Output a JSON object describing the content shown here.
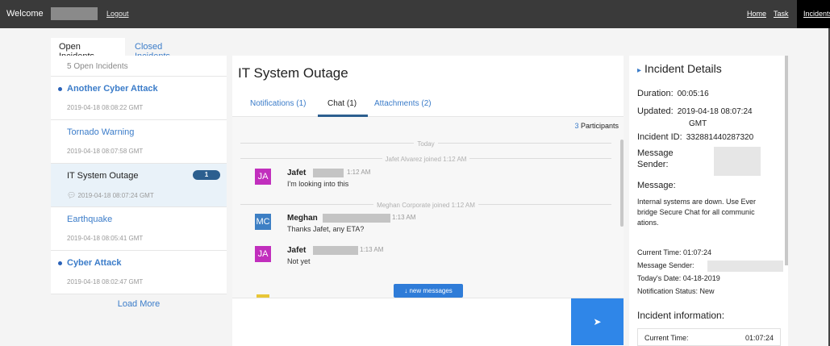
{
  "topbar": {
    "welcome": "Welcome",
    "logout": "Logout",
    "nav": [
      "Home",
      "Task",
      "Incidents"
    ]
  },
  "tabs": [
    "Open Incidents",
    "Closed Incidents"
  ],
  "incidents": {
    "count_label": "5 Open Incidents",
    "items": [
      {
        "title": "Another Cyber Attack",
        "date": "2019-04-18 08:08:22 GMT",
        "unread": true
      },
      {
        "title": "Tornado Warning",
        "date": "2019-04-18 08:07:58 GMT",
        "unread": false
      },
      {
        "title": "IT System Outage",
        "date": "2019-04-18 08:07:24 GMT",
        "unread": false,
        "badge": "1"
      },
      {
        "title": "Earthquake",
        "date": "2019-04-18 08:05:41 GMT",
        "unread": false
      },
      {
        "title": "Cyber Attack",
        "date": "2019-04-18 08:02:47 GMT",
        "unread": true
      }
    ],
    "load_more": "Load More"
  },
  "main": {
    "title": "IT System Outage",
    "tabs": [
      "Notifications (1)",
      "Chat (1)",
      "Attachments (2)"
    ],
    "participants_count": "3",
    "participants_label": "Participants",
    "divider_today": "Today",
    "divider_jafet": "Jafet Alvarez joined 1:12 AM",
    "divider_meghan": "Meghan Corporate joined 1:12 AM",
    "new_messages": "new messages",
    "messages": [
      {
        "initials": "JA",
        "name": "Jafet",
        "time": "1:12 AM",
        "text": "I'm looking into this"
      },
      {
        "initials": "MC",
        "name": "Meghan",
        "time": "1:13 AM",
        "text": "Thanks Jafet, any ETA?"
      },
      {
        "initials": "JA",
        "name": "Jafet",
        "time": "1:13 AM",
        "text": "Not yet"
      }
    ]
  },
  "details": {
    "title": "Incident Details",
    "duration_label": "Duration:",
    "duration": "00:05:16",
    "updated_label": "Updated:",
    "updated_date": "2019-04-18 08:07:24",
    "updated_tz": "GMT",
    "id_label": "Incident ID:",
    "id": "332881440287320",
    "sender_label": "Message Sender:",
    "message_label": "Message:",
    "message": "Internal systems are down. Use Ever bridge Secure Chat for all communic ations.",
    "current_time": "Current Time: 01:07:24",
    "message_sender": "Message Sender:",
    "todays_date": "Today's Date: 04-18-2019",
    "notification_status": "Notification Status: New",
    "info_label": "Incident information:",
    "info_current_time_label": "Current Time:",
    "info_current_time": "01:07:24"
  }
}
